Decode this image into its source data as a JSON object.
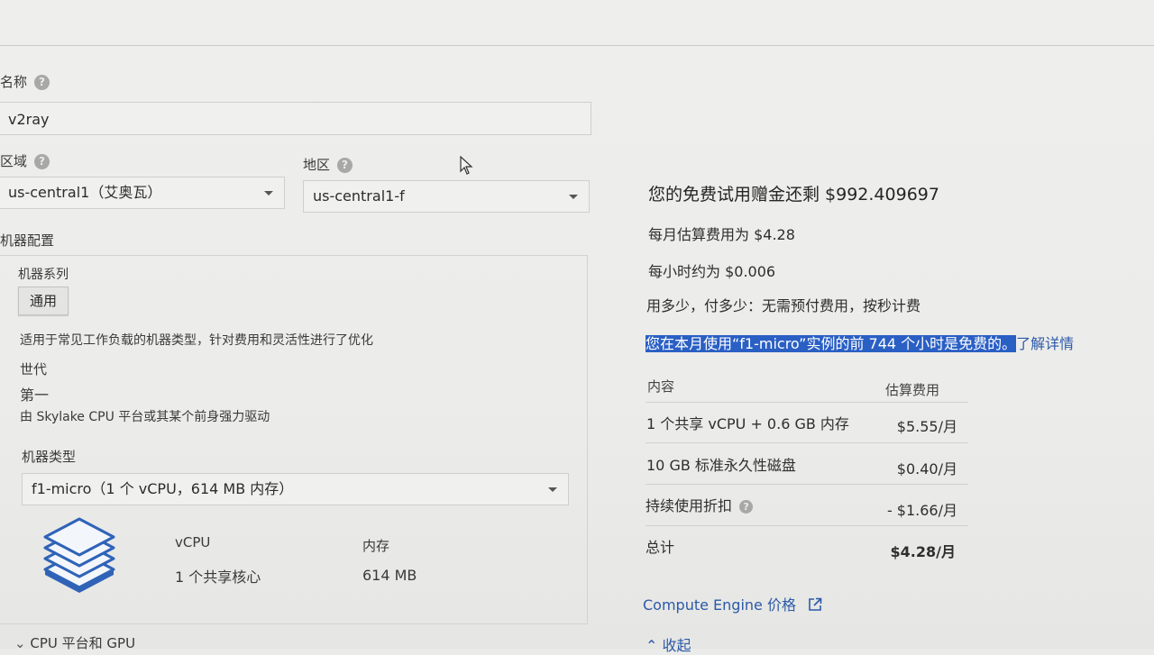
{
  "form": {
    "name_label": "名称",
    "name_value": "v2ray",
    "region_label": "区域",
    "region_value": "us-central1（艾奥瓦）",
    "zone_label": "地区",
    "zone_value": "us-central1-f",
    "machine_config_label": "机器配置",
    "machine_series_label": "机器系列",
    "general_chip": "通用",
    "general_desc": "适用于常见工作负载的机器类型，针对费用和灵活性进行了优化",
    "generation_label": "世代",
    "generation_value": "第一",
    "generation_desc": "由 Skylake CPU 平台或其某个前身强力驱动",
    "machine_type_label": "机器类型",
    "machine_type_value": "f1-micro（1 个 vCPU，614 MB 内存）",
    "vcpu_label": "vCPU",
    "vcpu_value": "1 个共享核心",
    "memory_label": "内存",
    "memory_value": "614 MB",
    "cpu_gpu_link": "CPU 平台和 GPU"
  },
  "summary": {
    "credit": "您的免费试用赠金还剩 $992.409697",
    "monthly": "每月估算费用为 $4.28",
    "hourly": "每小时约为 $0.006",
    "pay_as_you_go": "用多少，付多少：无需预付费用，按秒计费",
    "free_note": "您在本月使用“f1-micro”实例的前 744 个小时是免费的。",
    "learn_more": "了解详情",
    "table": {
      "col_item": "内容",
      "col_cost": "估算费用",
      "rows": [
        {
          "item": "1 个共享 vCPU + 0.6 GB 内存",
          "cost": "$5.55/月"
        },
        {
          "item": "10 GB 标准永久性磁盘",
          "cost": "$0.40/月"
        },
        {
          "item": "持续使用折扣",
          "cost": "- $1.66/月"
        },
        {
          "item": "总计",
          "cost": "$4.28/月"
        }
      ]
    },
    "pricing_link": "Compute Engine 价格",
    "collapse": "收起"
  }
}
